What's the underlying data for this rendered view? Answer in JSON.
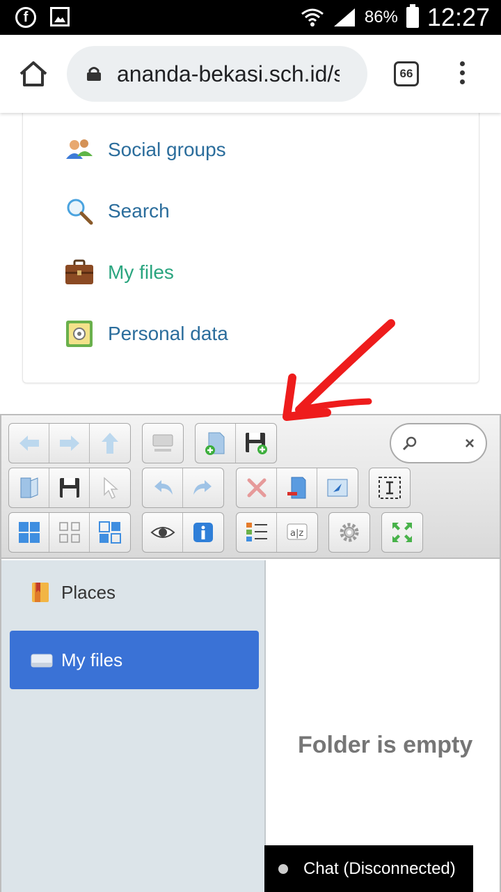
{
  "status_bar": {
    "battery": "86%",
    "time": "12:27"
  },
  "browser": {
    "url": "ananda-bekasi.sch.id/s",
    "tab_count": "66"
  },
  "nav": {
    "items": [
      {
        "label": "Social groups",
        "icon": "social-groups-icon"
      },
      {
        "label": "Search",
        "icon": "magnifier-icon"
      },
      {
        "label": "My files",
        "icon": "briefcase-icon",
        "active": true
      },
      {
        "label": "Personal data",
        "icon": "safe-icon"
      }
    ]
  },
  "file_manager": {
    "sidebar": {
      "places_label": "Places",
      "myfiles_label": "My files"
    },
    "main": {
      "empty_message": "Folder is empty"
    }
  },
  "chat": {
    "label": "Chat (Disconnected)"
  },
  "colors": {
    "link": "#2b6d9c",
    "active_link": "#2aa57f",
    "selected_row": "#3a72d6",
    "sidebar_bg": "#dce4e9",
    "annotation_arrow": "#ee1c1c"
  }
}
